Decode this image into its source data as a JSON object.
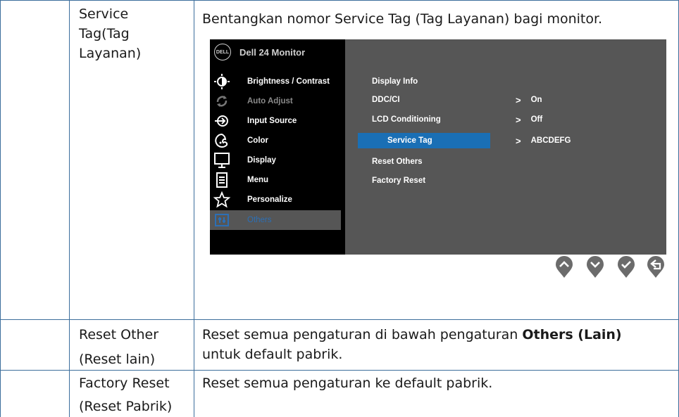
{
  "rows": [
    {
      "label_lines": [
        "Service",
        "Tag(Tag",
        "Layanan)"
      ],
      "description": "Bentangkan nomor Service Tag (Tag Layanan) bagi monitor."
    },
    {
      "label_lines": [
        "Reset Other",
        "(Reset lain)"
      ],
      "description_pre": "Reset semua pengaturan di bawah pengaturan ",
      "description_bold": "Others (Lain)",
      "description_post": "untuk default pabrik."
    },
    {
      "label_lines": [
        "Factory Reset",
        "(Reset Pabrik)"
      ],
      "description": "Reset semua pengaturan ke default pabrik."
    }
  ],
  "osd": {
    "logo_text": "DELL",
    "model": "Dell 24 Monitor",
    "menu": [
      {
        "label": "Brightness / Contrast",
        "icon": "brightness-icon"
      },
      {
        "label": "Auto Adjust",
        "icon": "auto-adjust-icon",
        "dim": true
      },
      {
        "label": "Input Source",
        "icon": "input-source-icon"
      },
      {
        "label": "Color",
        "icon": "color-icon"
      },
      {
        "label": "Display",
        "icon": "display-icon"
      },
      {
        "label": "Menu",
        "icon": "menu-icon"
      },
      {
        "label": "Personalize",
        "icon": "star-icon"
      },
      {
        "label": "Others",
        "icon": "others-icon",
        "active": true
      }
    ],
    "submenu": [
      {
        "label": "Display Info"
      },
      {
        "label": "DDC/CI",
        "value": "On"
      },
      {
        "label": "LCD Conditioning",
        "value": "Off"
      },
      {
        "label": "Service Tag",
        "value": "ABCDEFG",
        "selected": true
      },
      {
        "label": "Reset Others"
      },
      {
        "label": "Factory Reset"
      }
    ],
    "value_chevron": ">",
    "buttons": [
      "up-button",
      "down-button",
      "confirm-button",
      "back-button"
    ],
    "colors": {
      "selection": "#1a6fb5",
      "panel": "#565656",
      "active_text": "#2c6fb5",
      "button": "#6b6b6b"
    }
  }
}
